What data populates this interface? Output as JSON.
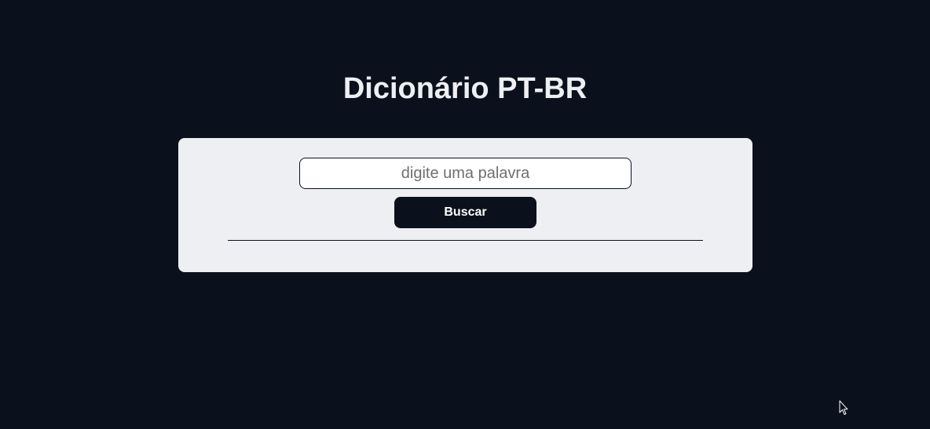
{
  "header": {
    "title": "Dicionário PT-BR"
  },
  "search": {
    "placeholder": "digite uma palavra",
    "value": "",
    "button_label": "Buscar"
  },
  "colors": {
    "background": "#0b111c",
    "card": "#edeff3",
    "button": "#0b111c",
    "title_text": "#edeff3"
  },
  "icons": {
    "cursor": "mouse-pointer-icon"
  }
}
